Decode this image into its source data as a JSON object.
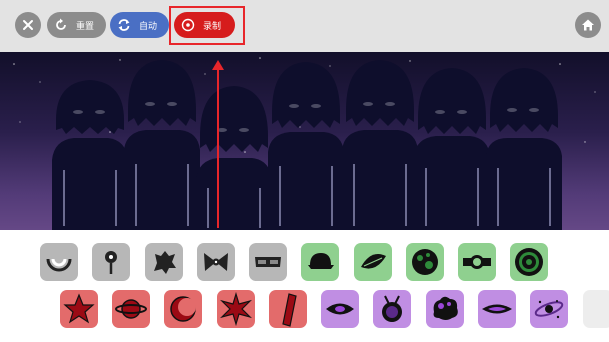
{
  "toolbar": {
    "close_icon": "close-icon",
    "reset_label": "重置",
    "auto_label": "自动",
    "record_label": "录制",
    "home_icon": "home-icon",
    "colors": {
      "bar": "#e3e3e3",
      "gray_button": "#8c8c8c",
      "auto_button": "#4a6fc4",
      "record_button": "#d61c1c",
      "highlight": "#e8262b"
    }
  },
  "stage": {
    "performer_count": 7,
    "colors": {
      "silhouette": "#0e0e2c",
      "sky_top": "#120f2a",
      "sky_bottom": "#654886"
    }
  },
  "sound_tray": {
    "row1": [
      {
        "icon": "arc-icon",
        "color": "gray"
      },
      {
        "icon": "mic-icon",
        "color": "gray"
      },
      {
        "icon": "splash-icon",
        "color": "gray"
      },
      {
        "icon": "bow-icon",
        "color": "gray"
      },
      {
        "icon": "glasses-icon",
        "color": "gray"
      },
      {
        "icon": "cap-icon",
        "color": "green"
      },
      {
        "icon": "leaf-icon",
        "color": "green"
      },
      {
        "icon": "planet-icon",
        "color": "green"
      },
      {
        "icon": "watch-icon",
        "color": "green"
      },
      {
        "icon": "target-icon",
        "color": "green"
      }
    ],
    "row2": [
      {
        "icon": "star-icon",
        "color": "red"
      },
      {
        "icon": "ringed-planet-icon",
        "color": "red"
      },
      {
        "icon": "crescent-icon",
        "color": "red"
      },
      {
        "icon": "burst-icon",
        "color": "red"
      },
      {
        "icon": "bar-icon",
        "color": "red"
      },
      {
        "icon": "eye-icon",
        "color": "purple"
      },
      {
        "icon": "pendant-icon",
        "color": "purple"
      },
      {
        "icon": "fluffy-icon",
        "color": "purple"
      },
      {
        "icon": "slit-eye-icon",
        "color": "purple"
      },
      {
        "icon": "galaxy-icon",
        "color": "purple"
      },
      {
        "icon": "empty-slot",
        "color": "blank"
      }
    ]
  }
}
